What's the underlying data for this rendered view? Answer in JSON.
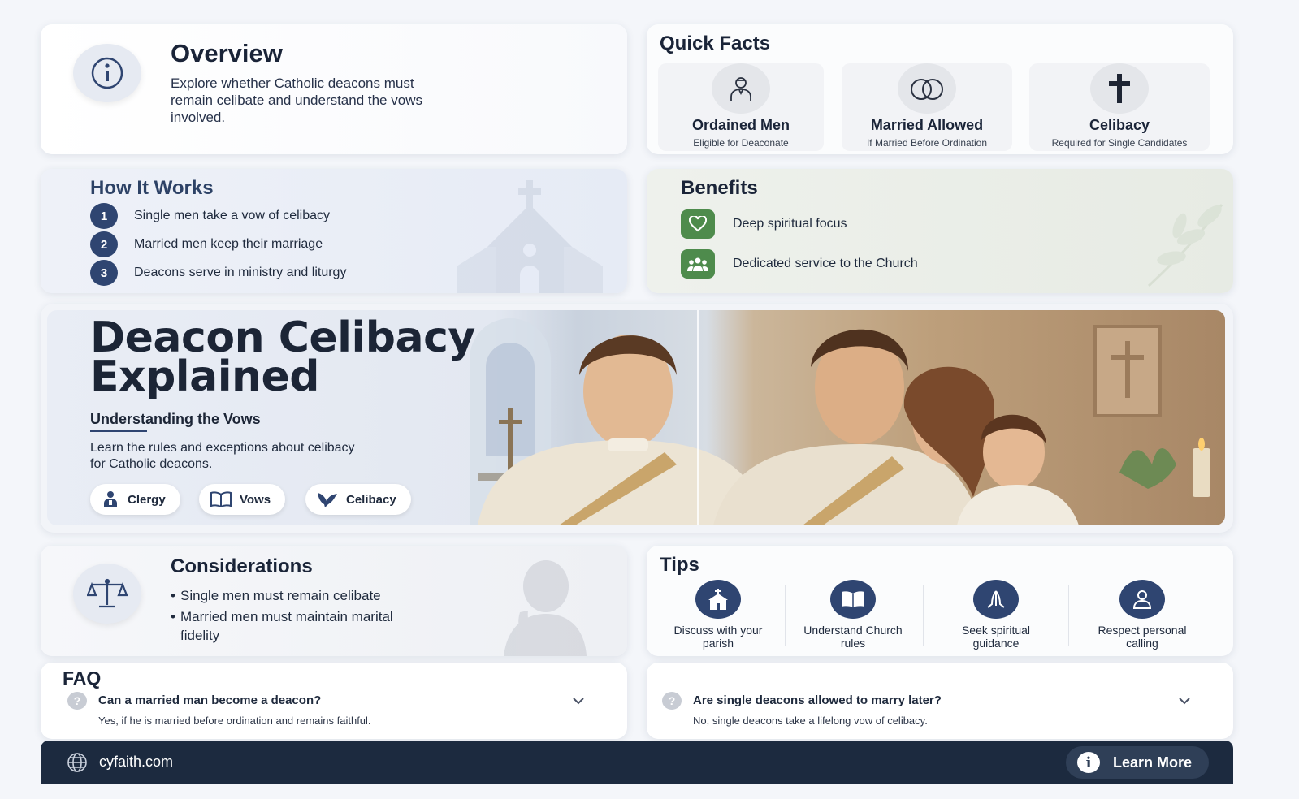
{
  "overview": {
    "title": "Overview",
    "text": "Explore whether Catholic deacons must remain celibate and understand the vows involved.",
    "icon": "info-icon"
  },
  "quick_facts": {
    "title": "Quick Facts",
    "items": [
      {
        "name": "Ordained Men",
        "sub": "Eligible for Deaconate",
        "icon": "person-icon"
      },
      {
        "name": "Married Allowed",
        "sub": "If Married Before Ordination",
        "icon": "rings-icon"
      },
      {
        "name": "Celibacy",
        "sub": "Required for Single Candidates",
        "icon": "cross-icon"
      }
    ]
  },
  "how_it_works": {
    "title": "How It Works",
    "steps": [
      {
        "num": "1",
        "text": "Single men take a vow of celibacy"
      },
      {
        "num": "2",
        "text": "Married men keep their marriage"
      },
      {
        "num": "3",
        "text": "Deacons serve in ministry and liturgy"
      }
    ]
  },
  "benefits": {
    "title": "Benefits",
    "items": [
      {
        "text": "Deep spiritual focus",
        "icon": "heart-icon"
      },
      {
        "text": "Dedicated service to the Church",
        "icon": "group-icon"
      }
    ],
    "accent": "#4e8b4c"
  },
  "hero": {
    "title_line1": "Deacon Celibacy",
    "title_line2": "Explained",
    "subtitle": "Understanding the Vows",
    "description": "Learn the rules and exceptions about celibacy for Catholic deacons.",
    "pills": [
      {
        "label": "Clergy",
        "icon": "clergy-icon"
      },
      {
        "label": "Vows",
        "icon": "book-icon"
      },
      {
        "label": "Celibacy",
        "icon": "dove-icon"
      }
    ]
  },
  "considerations": {
    "title": "Considerations",
    "items": [
      "Single men must remain celibate",
      "Married men must maintain marital fidelity"
    ],
    "icon": "scales-icon"
  },
  "tips": {
    "title": "Tips",
    "items": [
      {
        "text": "Discuss with your parish",
        "icon": "church-icon"
      },
      {
        "text": "Understand Church rules",
        "icon": "book-icon"
      },
      {
        "text": "Seek spiritual guidance",
        "icon": "praying-hands-icon"
      },
      {
        "text": "Respect personal calling",
        "icon": "person-icon"
      }
    ],
    "accent": "#2f4571"
  },
  "faq": {
    "title": "FAQ",
    "items": [
      {
        "question": "Can a married man become a deacon?",
        "answer": "Yes, if he is married before ordination and remains faithful."
      },
      {
        "question": "Are single deacons allowed to marry later?",
        "answer": "No, single deacons take a lifelong vow of celibacy."
      }
    ],
    "q_mark": "?"
  },
  "footer": {
    "site": "cyfaith.com",
    "button_label": "Learn More",
    "button_icon_glyph": "i",
    "background": "#1c2a3f"
  }
}
